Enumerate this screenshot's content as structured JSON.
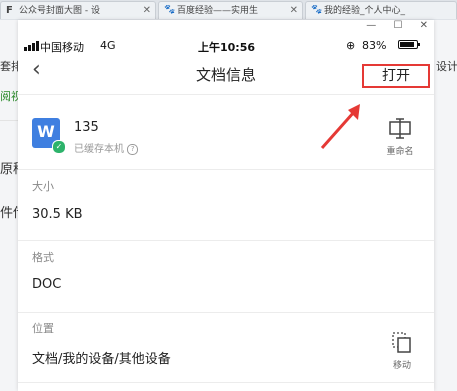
{
  "browser": {
    "tabs": [
      {
        "icon": "F",
        "label": "公众号封面大图 - 设"
      },
      {
        "icon": "🐾",
        "label": "百度经验——实用生"
      },
      {
        "icon": "🐾",
        "label": "我的经验_个人中心_"
      }
    ],
    "side_left": [
      "套排",
      "阅视",
      "原稿",
      "件传"
    ],
    "side_right": [
      "设计"
    ]
  },
  "status": {
    "carrier": "中国移动",
    "network": "4G",
    "time": "上午10:56",
    "battery": "83%"
  },
  "nav": {
    "title": "文档信息",
    "open_label": "打开"
  },
  "file": {
    "icon_letter": "W",
    "name": "135",
    "cached_text": "已缓存本机",
    "help": "?",
    "rename_label": "重命名"
  },
  "sections": {
    "size_label": "大小",
    "size_value": "30.5 KB",
    "format_label": "格式",
    "format_value": "DOC",
    "location_label": "位置",
    "location_value": "文档/我的设备/其他设备",
    "move_label": "移动"
  },
  "colors": {
    "accent_red": "#e53935",
    "doc_blue": "#3f7fe0",
    "cached_green": "#2db36b"
  }
}
